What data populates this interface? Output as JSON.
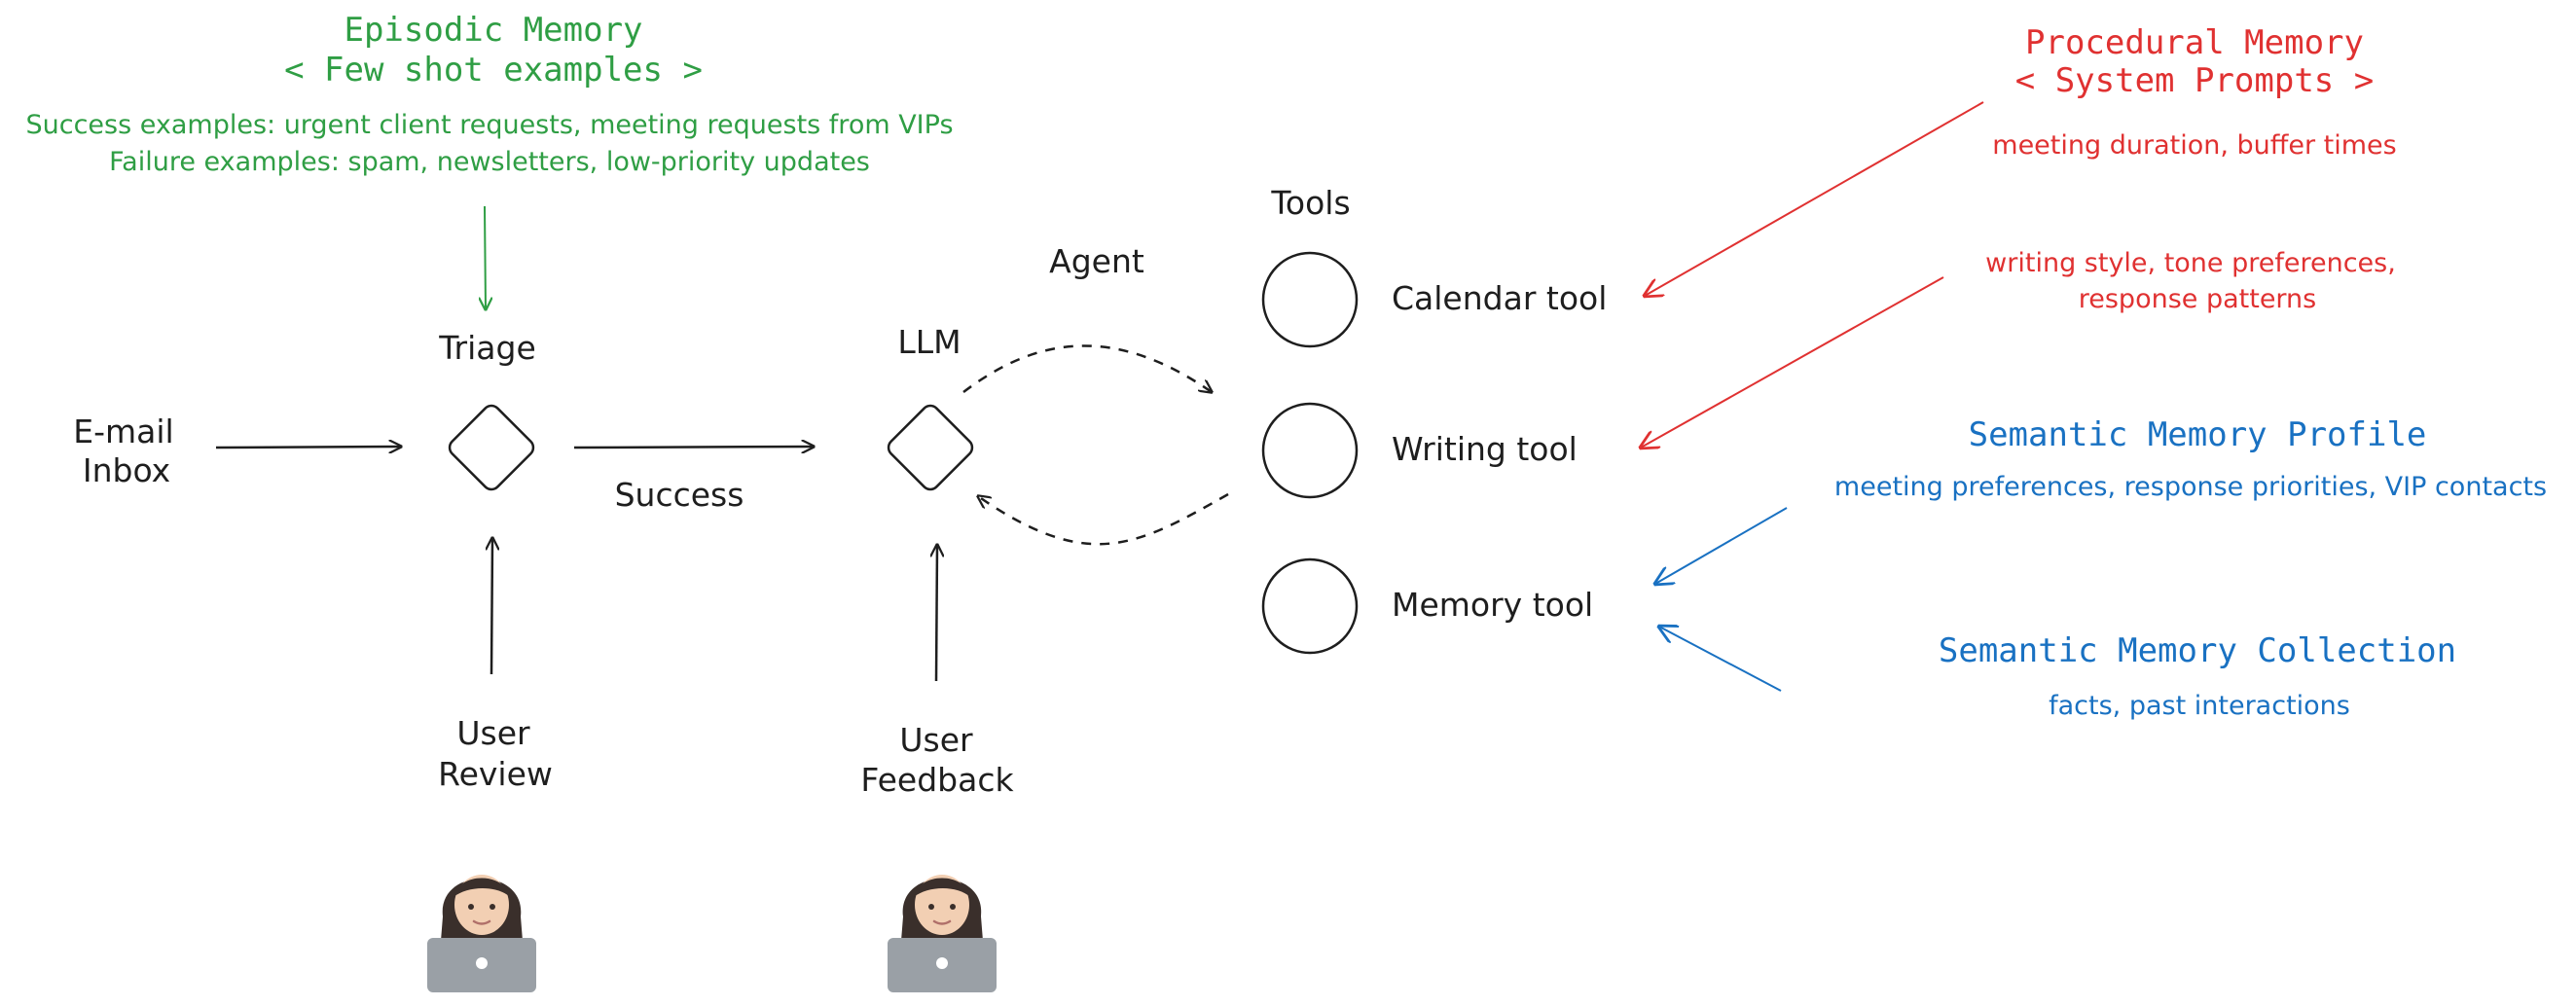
{
  "colors": {
    "ink": "#1e1e1e",
    "episodic": "#2f9e44",
    "procedural": "#e03131",
    "semantic": "#1971c2"
  },
  "episodic": {
    "title": "Episodic Memory",
    "subtitle": "< Few shot examples >",
    "line1": "Success examples: urgent client requests, meeting requests from VIPs",
    "line2": "Failure examples: spam, newsletters, low-priority updates"
  },
  "procedural": {
    "title": "Procedural Memory",
    "subtitle": "< System Prompts >",
    "calendar_note": "meeting duration, buffer times",
    "writing_note_1": "writing style, tone preferences,",
    "writing_note_2": "response patterns"
  },
  "semantic_profile": {
    "title": "Semantic Memory Profile",
    "note": "meeting preferences, response priorities, VIP contacts"
  },
  "semantic_collection": {
    "title": "Semantic Memory Collection",
    "note": "facts, past interactions"
  },
  "nodes": {
    "email_line1": "E-mail",
    "email_line2": "Inbox",
    "triage": "Triage",
    "success": "Success",
    "llm": "LLM",
    "agent": "Agent",
    "tools_header": "Tools",
    "calendar_tool": "Calendar tool",
    "writing_tool": "Writing tool",
    "memory_tool": "Memory tool",
    "user_review_1": "User",
    "user_review_2": "Review",
    "user_feedback_1": "User",
    "user_feedback_2": "Feedback"
  },
  "icons": {
    "user_review": "person-with-laptop-icon",
    "user_feedback": "person-with-laptop-icon"
  }
}
